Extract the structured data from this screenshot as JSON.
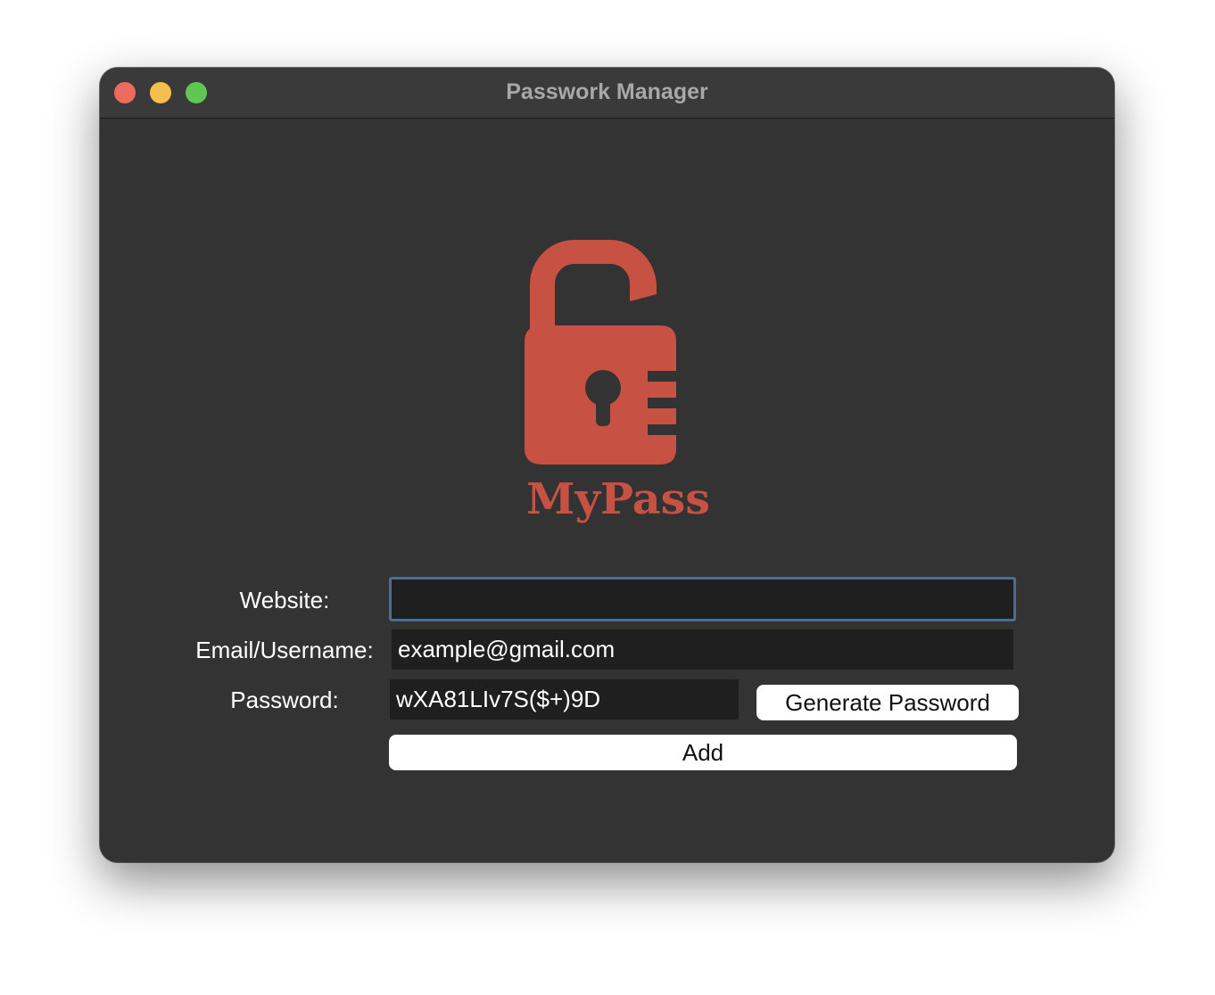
{
  "window": {
    "title": "Passwork Manager"
  },
  "logo": {
    "text": "MyPass",
    "color": "#c75143",
    "icon": "open-padlock-icon"
  },
  "form": {
    "website_label": "Website:",
    "website_value": "",
    "email_label": "Email/Username:",
    "email_value": "example@gmail.com",
    "password_label": "Password:",
    "password_value": "wXA81LIv7S($+)9D",
    "generate_label": "Generate Password",
    "add_label": "Add"
  },
  "colors": {
    "window_bg": "#333333",
    "field_bg": "#1f1f1f",
    "focus_ring": "#4a6d97",
    "close": "#ed6a5e",
    "minimize": "#f5bf4f",
    "zoom": "#61c554"
  }
}
